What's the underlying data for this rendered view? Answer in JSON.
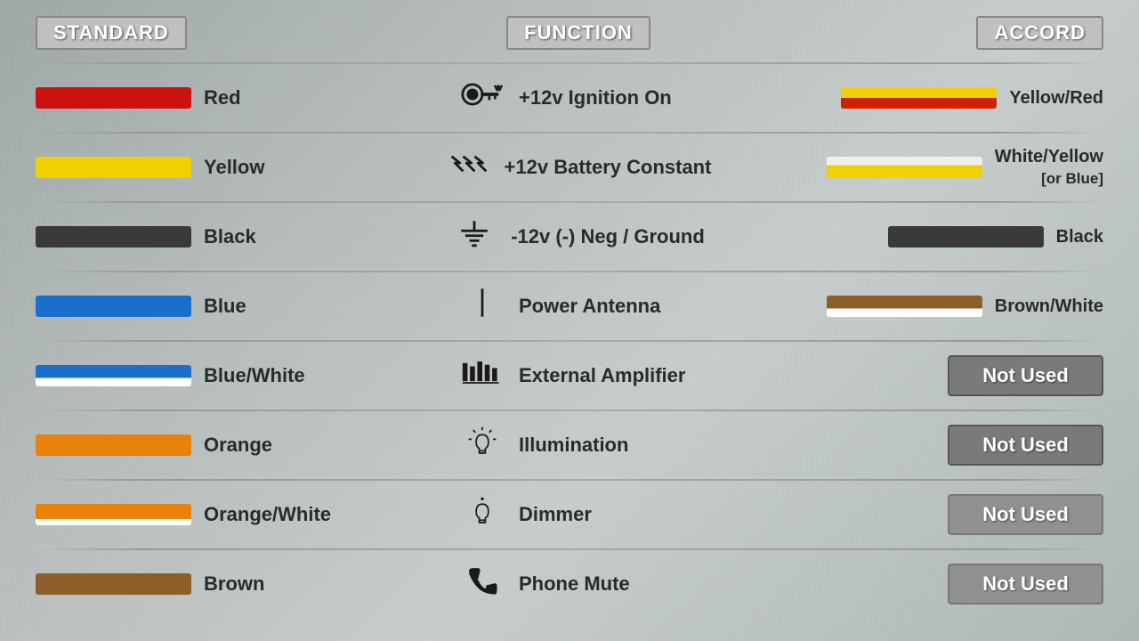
{
  "headers": {
    "standard": "STANDARD",
    "function": "FUNCTION",
    "accord": "ACCORD"
  },
  "rows": [
    {
      "id": "red",
      "wire_color": "Red",
      "wire_style": "solid_red",
      "function_text": "+12v  Ignition On",
      "function_icon": "ignition",
      "accord_text": "Yellow/Red",
      "accord_style": "yellow_red",
      "accord_type": "wire"
    },
    {
      "id": "yellow",
      "wire_color": "Yellow",
      "wire_style": "solid_yellow",
      "function_text": "+12v  Battery Constant",
      "function_icon": "battery",
      "accord_text": "White/Yellow\n[or Blue]",
      "accord_text_line1": "White/Yellow",
      "accord_text_line2": "[or Blue]",
      "accord_style": "white_yellow",
      "accord_type": "wire"
    },
    {
      "id": "black",
      "wire_color": "Black",
      "wire_style": "solid_black",
      "function_text": "-12v (-) Neg / Ground",
      "function_icon": "ground",
      "accord_text": "Black",
      "accord_style": "solid_black",
      "accord_type": "wire"
    },
    {
      "id": "blue",
      "wire_color": "Blue",
      "wire_style": "solid_blue",
      "function_text": "Power  Antenna",
      "function_icon": "antenna",
      "accord_text": "Brown/White",
      "accord_style": "brown_white",
      "accord_type": "wire"
    },
    {
      "id": "blue_white",
      "wire_color": "Blue/White",
      "wire_style": "blue_white",
      "function_text": "External Amplifier",
      "function_icon": "amplifier",
      "accord_text": "Not Used",
      "accord_type": "not_used",
      "not_used_style": "bright"
    },
    {
      "id": "orange",
      "wire_color": "Orange",
      "wire_style": "solid_orange",
      "function_text": "Illumination",
      "function_icon": "illumination",
      "accord_text": "Not Used",
      "accord_type": "not_used",
      "not_used_style": "bright"
    },
    {
      "id": "orange_white",
      "wire_color": "Orange/White",
      "wire_style": "orange_white",
      "function_text": "Dimmer",
      "function_icon": "dimmer",
      "accord_text": "Not Used",
      "accord_type": "not_used",
      "not_used_style": "dim"
    },
    {
      "id": "brown",
      "wire_color": "Brown",
      "wire_style": "solid_brown",
      "function_text": "Phone Mute",
      "function_icon": "phone",
      "accord_text": "Not Used",
      "accord_type": "not_used",
      "not_used_style": "dim"
    }
  ]
}
